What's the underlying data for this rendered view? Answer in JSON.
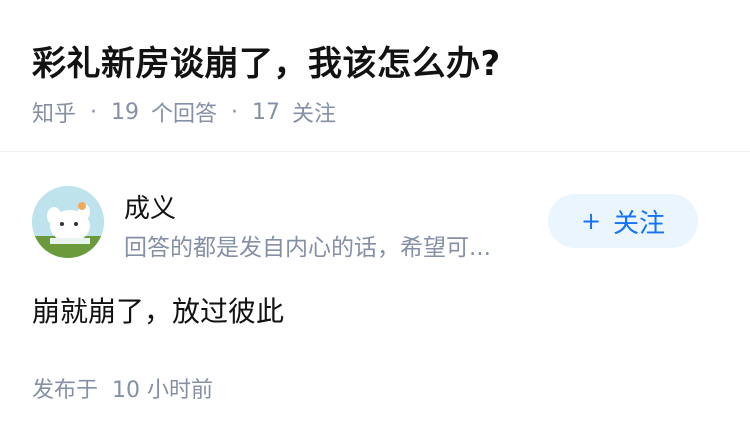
{
  "question": {
    "title": "彩礼新房谈崩了，我该怎么办?",
    "source": "知乎",
    "answers_count": "19",
    "answers_label": "个回答",
    "followers_count": "17",
    "followers_label": "关注"
  },
  "answer": {
    "author": {
      "name": "成义",
      "bio": "回答的都是发自内心的话，希望可...",
      "avatar_icon": "cartoon-cat-avatar"
    },
    "follow_button": {
      "icon": "plus-icon",
      "label": "关注"
    },
    "content": "崩就崩了，放过彼此",
    "publish_label": "发布于",
    "publish_time": "10 小时前"
  },
  "colors": {
    "accent": "#1772f6",
    "follow_bg": "#ebf5fd",
    "meta_text": "#8590a6",
    "main_text": "#121212"
  }
}
